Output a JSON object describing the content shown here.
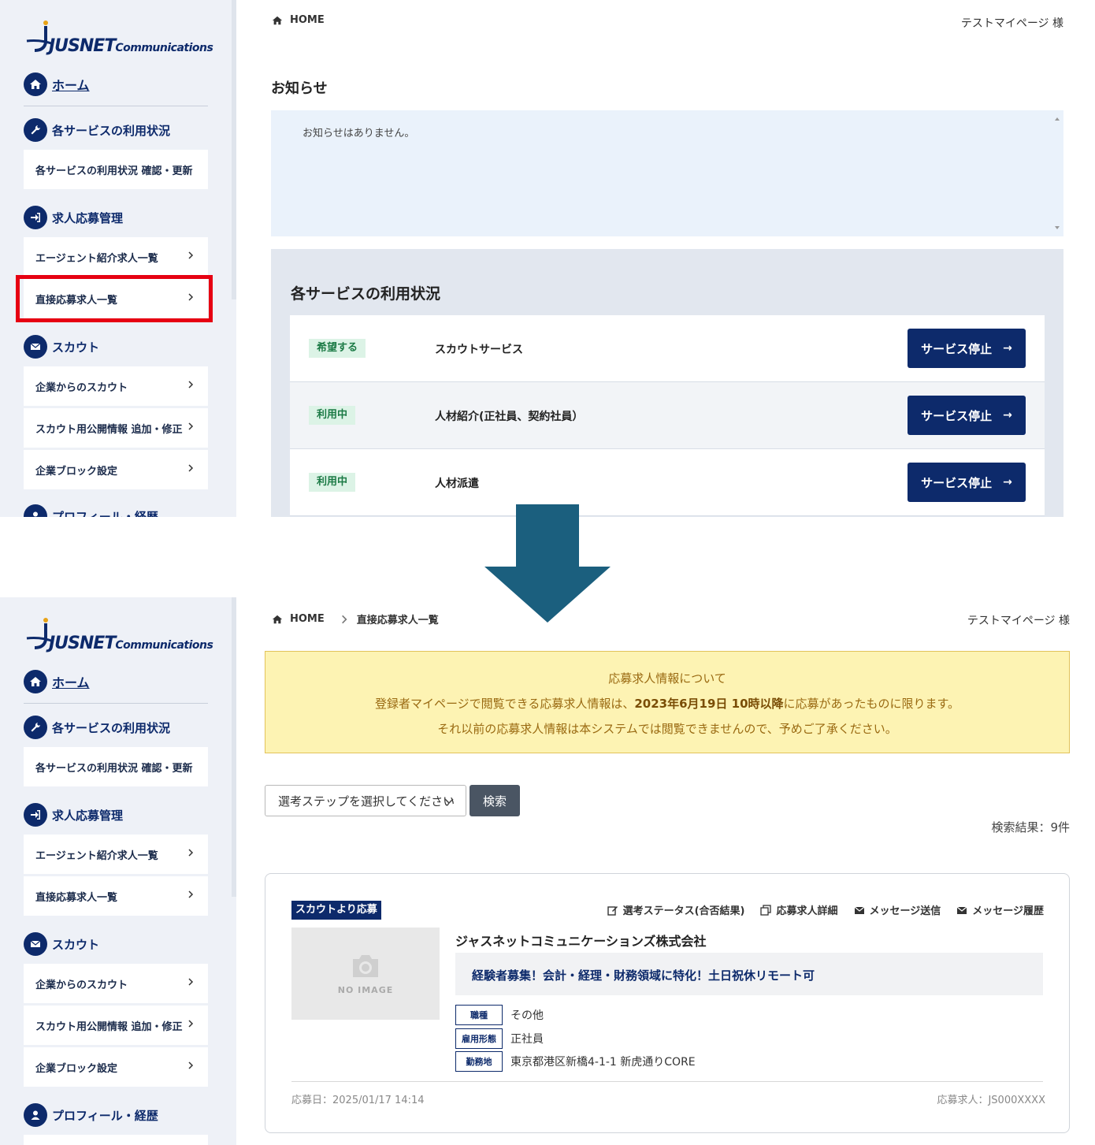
{
  "logo": {
    "main": "JUSNET",
    "sub": "Communications"
  },
  "sidebar": {
    "home": "ホーム",
    "section_service": "各サービスの利用状況",
    "item_service_check": "各サービスの利用状況 確認・更新",
    "section_job": "求人応募管理",
    "item_agent_jobs": "エージェント紹介求人一覧",
    "item_direct_jobs": "直接応募求人一覧",
    "section_scout": "スカウト",
    "item_company_scout": "企業からのスカウト",
    "item_scout_public": "スカウト用公開情報 追加・修正",
    "item_block": "企業ブロック設定",
    "section_profile": "プロフィール・経歴"
  },
  "top": {
    "breadcrumb_home": "HOME",
    "user": "テストマイページ 様",
    "notice_title": "お知らせ",
    "notice_empty": "お知らせはありません。",
    "usage_title": "各サービスの利用状況",
    "services": [
      {
        "status": "希望する",
        "name": "スカウトサービス",
        "button": "サービス停止"
      },
      {
        "status": "利用中",
        "name": "人材紹介(正社員、契約社員）",
        "button": "サービス停止"
      },
      {
        "status": "利用中",
        "name": "人材派遣",
        "button": "サービス停止"
      }
    ]
  },
  "bottom": {
    "breadcrumb_home": "HOME",
    "breadcrumb_current": "直接応募求人一覧",
    "user": "テストマイページ 様",
    "info_heading": "応募求人情報について",
    "info_line2_pre": "登録者マイページで閲覧できる応募求人情報は、",
    "info_line2_bold": "2023年6月19日 10時以降",
    "info_line2_post": "に応募があったものに限ります。",
    "info_line3": "それ以前の応募求人情報は本システムでは閲覧できませんので、予めご了承ください。",
    "select_placeholder": "選考ステップを選択してください",
    "search_button": "検索",
    "result_count": "検索結果：9件",
    "card": {
      "tag": "スカウトより応募",
      "actions": [
        "選考ステータス(合否結果)",
        "応募求人詳細",
        "メッセージ送信",
        "メッセージ履歴"
      ],
      "no_image": "NO IMAGE",
      "company": "ジャスネットコミュニケーションズ株式会社",
      "job_title": "経験者募集！会計・経理・財務領域に特化！土日祝休リモート可",
      "attrs": [
        {
          "key": "職種",
          "value": "その他"
        },
        {
          "key": "雇用形態",
          "value": "正社員"
        },
        {
          "key": "勤務地",
          "value": "東京都港区新橋4-1-1 新虎通りCORE"
        }
      ],
      "applied_date": "応募日：2025/01/17 14:14",
      "applied_id": "応募求人：JS000XXXX"
    }
  },
  "colors": {
    "navy": "#0d2a6b",
    "highlight": "#e60012",
    "arrow": "#1b5f7e",
    "info_bg": "#fdf3b3"
  }
}
